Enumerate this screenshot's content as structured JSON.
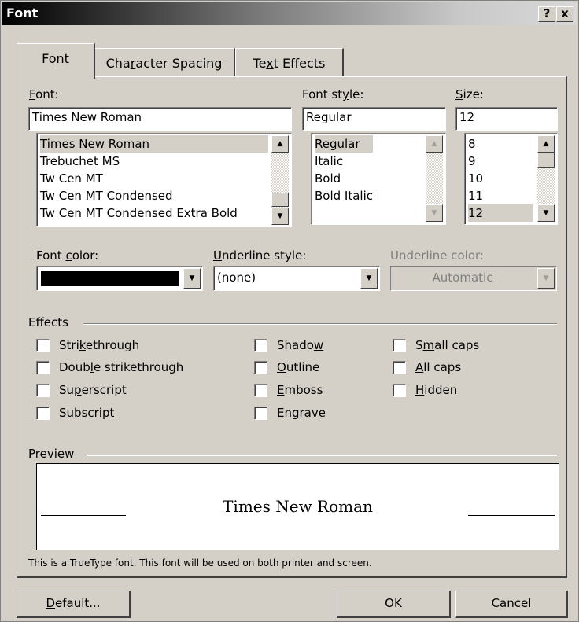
{
  "window": {
    "title": "Font",
    "help_button": "?",
    "close_button": "x"
  },
  "tabs": [
    {
      "label": "Font",
      "mnemonic": "n",
      "active": true
    },
    {
      "label": "Character Spacing",
      "mnemonic": "r",
      "active": false
    },
    {
      "label": "Text Effects",
      "mnemonic": "x",
      "active": false
    }
  ],
  "font": {
    "label": "Font:",
    "value": "Times New Roman",
    "items": [
      "Times New Roman",
      "Trebuchet MS",
      "Tw Cen MT",
      "Tw Cen MT Condensed",
      "Tw Cen MT Condensed Extra Bold"
    ],
    "selected": "Times New Roman"
  },
  "font_style": {
    "label": "Font style:",
    "value": "Regular",
    "items": [
      "Regular",
      "Italic",
      "Bold",
      "Bold Italic"
    ],
    "selected": "Regular"
  },
  "size": {
    "label": "Size:",
    "value": "12",
    "items": [
      "8",
      "9",
      "10",
      "11",
      "12"
    ],
    "selected": "12"
  },
  "font_color": {
    "label": "Font color:",
    "value_color": "#000000"
  },
  "underline_style": {
    "label": "Underline style:",
    "value": "(none)"
  },
  "underline_color": {
    "label": "Underline color:",
    "value": "Automatic",
    "disabled": true
  },
  "effects": {
    "label": "Effects",
    "items": [
      {
        "label": "Strikethrough",
        "checked": false
      },
      {
        "label": "Double strikethrough",
        "checked": false
      },
      {
        "label": "Superscript",
        "checked": false
      },
      {
        "label": "Subscript",
        "checked": false
      },
      {
        "label": "Shadow",
        "checked": false
      },
      {
        "label": "Outline",
        "checked": false
      },
      {
        "label": "Emboss",
        "checked": false
      },
      {
        "label": "Engrave",
        "checked": false
      },
      {
        "label": "Small caps",
        "checked": false
      },
      {
        "label": "All caps",
        "checked": false
      },
      {
        "label": "Hidden",
        "checked": false
      }
    ]
  },
  "preview": {
    "label": "Preview",
    "sample_text": "Times New Roman",
    "info": "This is a TrueType font. This font will be used on both printer and screen."
  },
  "buttons": {
    "default": "Default...",
    "ok": "OK",
    "cancel": "Cancel"
  },
  "colors": {
    "face": "#d4d0c8",
    "titlebar_start": "#000000",
    "titlebar_end": "#d8d8d8"
  }
}
